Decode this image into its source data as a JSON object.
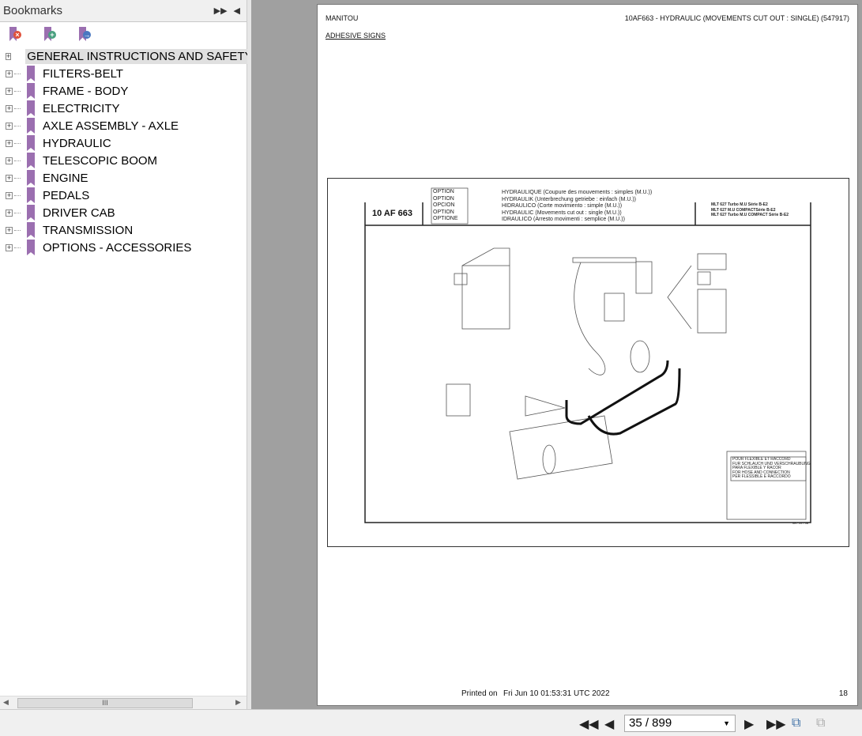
{
  "sidebar": {
    "title": "Bookmarks",
    "tools": [
      "delete-bookmark",
      "add-bookmark",
      "go-to-bookmark"
    ],
    "items": [
      {
        "label": "GENERAL INSTRUCTIONS AND SAFETY"
      },
      {
        "label": "FILTERS-BELT"
      },
      {
        "label": "FRAME - BODY"
      },
      {
        "label": "ELECTRICITY"
      },
      {
        "label": "AXLE ASSEMBLY - AXLE"
      },
      {
        "label": "HYDRAULIC"
      },
      {
        "label": "TELESCOPIC BOOM"
      },
      {
        "label": "ENGINE"
      },
      {
        "label": "PEDALS"
      },
      {
        "label": "DRIVER CAB"
      },
      {
        "label": "TRANSMISSION"
      },
      {
        "label": "OPTIONS - ACCESSORIES"
      }
    ]
  },
  "page": {
    "brand": "MANITOU",
    "header": "10AF663 - HYDRAULIC (MOVEMENTS CUT OUT : SINGLE) (547917)",
    "section": "ADHESIVE SIGNS",
    "printed_label": "Printed on",
    "printed_date": "Fri Jun 10 01:53:31 UTC 2022",
    "page_number": "18",
    "drawing": {
      "code": "10 AF 663",
      "options": [
        "OPTION",
        "OPTION",
        "OPCION",
        "OPTION",
        "OPTIONE"
      ],
      "titles": [
        "HYDRAULIQUE (Coupure des mouvements : simples (M.U.))",
        "HYDRAULIK (Unterbrechung getriebe : einfach (M.U.))",
        "HIDRAULICO (Corte movimiento : simple (M.U.))",
        "HYDRAULIC (Movements cut out : single (M.U.))",
        "IDRAULICO (Arresto movimenti : semplice (M.U.))"
      ],
      "models": [
        "MLT 627 Turbo M.U Série B-E2",
        "MLT 627  M.U COMPACTSérie B-E2",
        "MLT 627  Turbo M.U COMPACT Série B-E2"
      ],
      "hose_note": [
        "POUR FLEXIBLE ET RACCORD",
        "FUR SCHLAUCH UND VERSCHRAUBUNG",
        "PARA FLEXIBLE Y RACOR",
        "FOR HOSE AND CONNECTION",
        "PER FLESSIBLE E RACCORDO"
      ],
      "date": "08 / 10 / 08"
    }
  },
  "toolbar": {
    "page_value": "35 / 899"
  }
}
